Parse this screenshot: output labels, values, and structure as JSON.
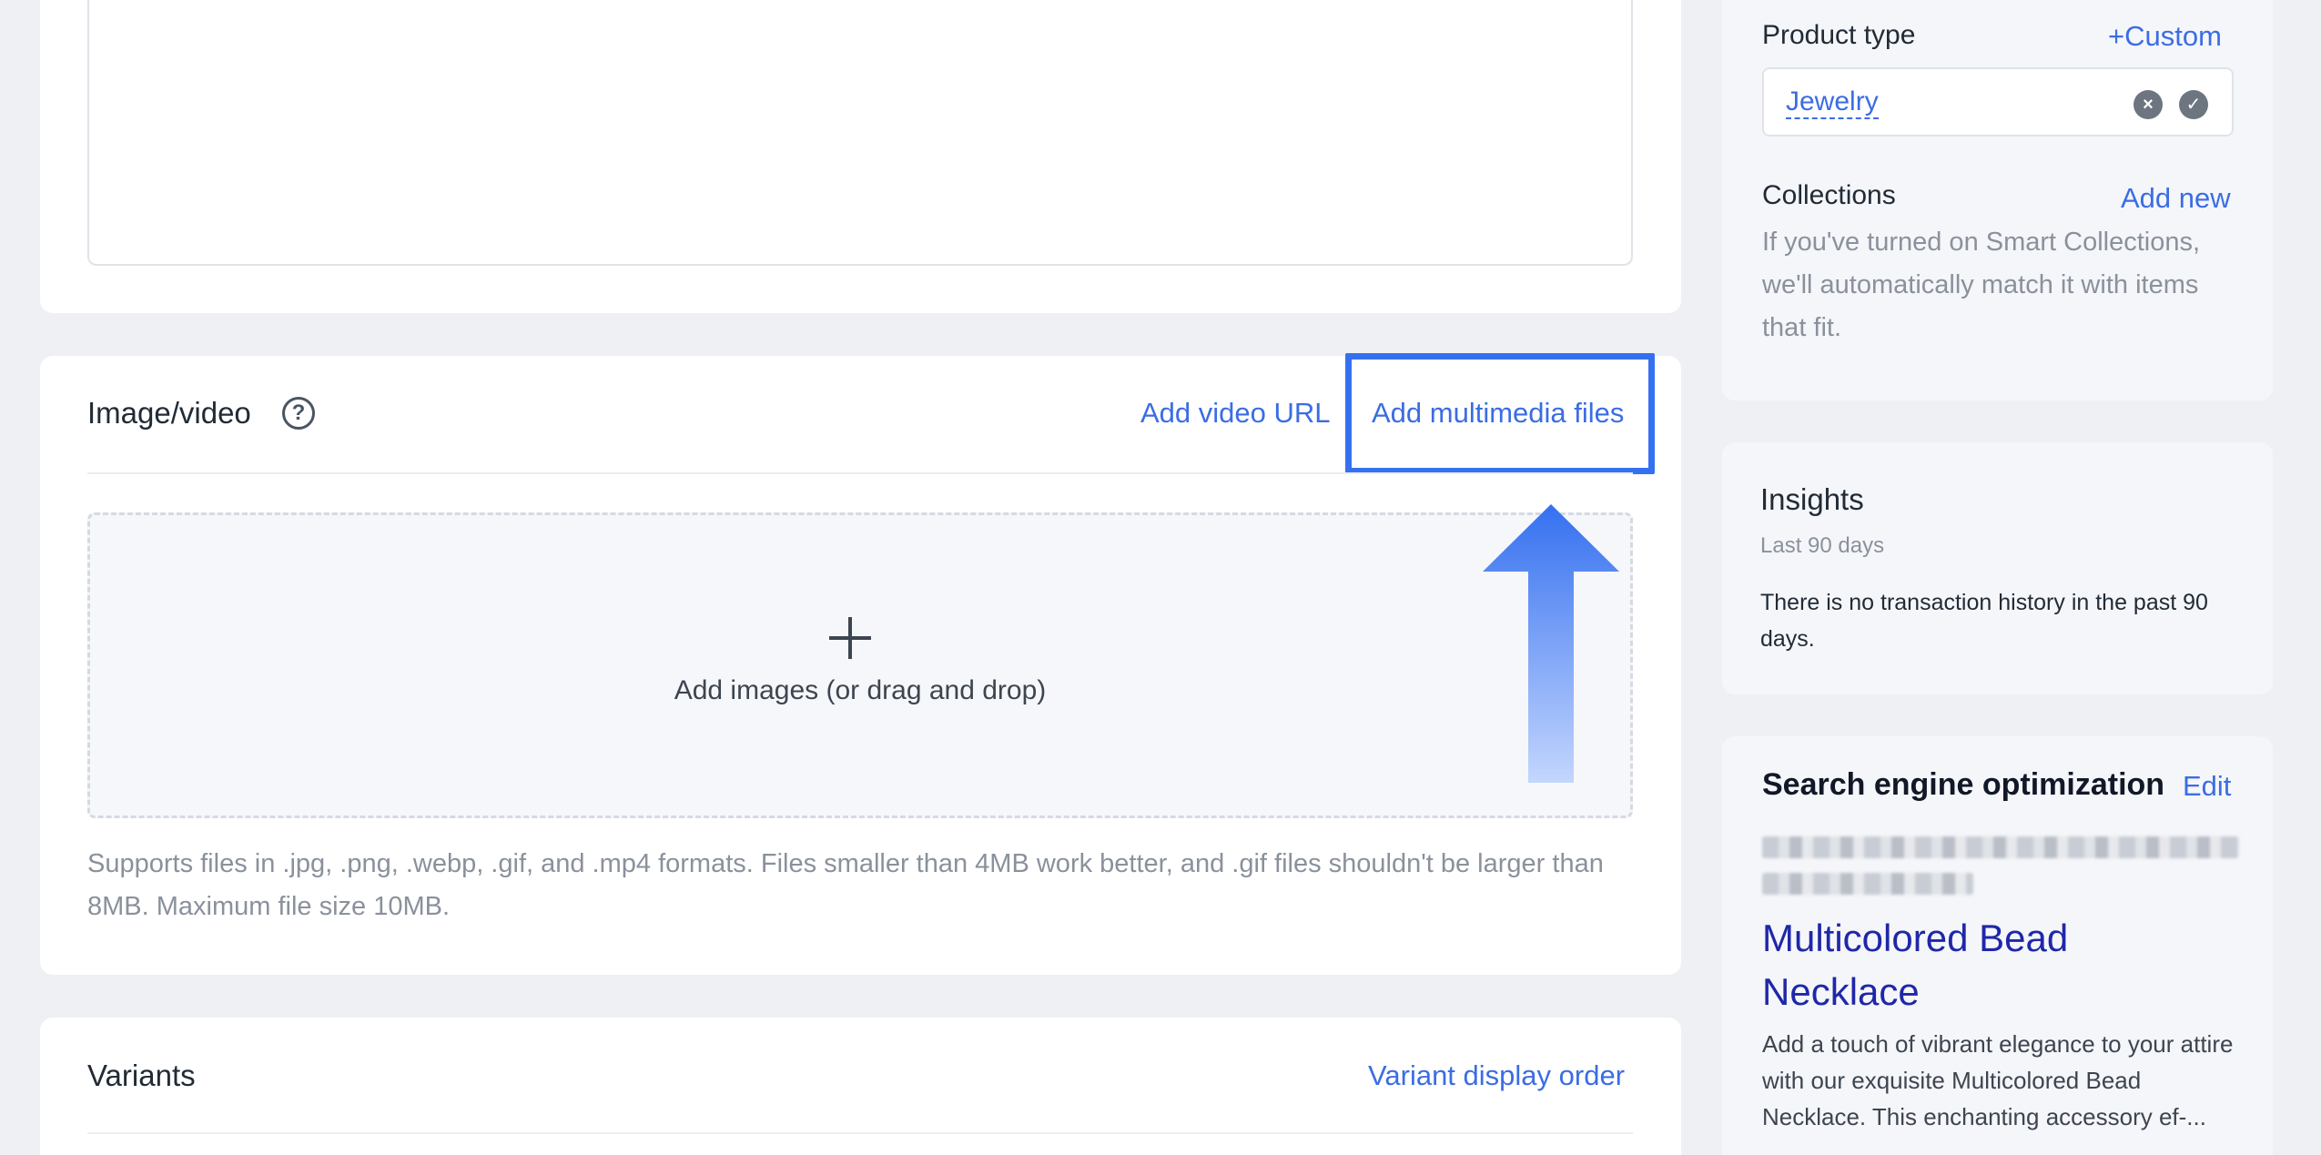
{
  "image_section": {
    "title": "Image/video",
    "add_video_url": "Add video URL",
    "add_multimedia_files": "Add multimedia files",
    "dropzone_label": "Add images (or drag and drop)",
    "support_text": "Supports files in .jpg, .png, .webp, .gif, and .mp4 formats. Files smaller than 4MB work better, and .gif files shouldn't be larger than 8MB. Maximum file size 10MB."
  },
  "variants_section": {
    "title": "Variants",
    "display_order_link": "Variant display order"
  },
  "product_organization": {
    "product_type_label": "Product type",
    "custom_link": "Custom",
    "custom_prefix": "+",
    "product_type_value": "Jewelry",
    "collections_label": "Collections",
    "add_new_link": "Add new",
    "collections_description": "If you've turned on Smart Collections, we'll automatically match it with items that fit."
  },
  "insights": {
    "title": "Insights",
    "period": "Last 90 days",
    "note": "There is no transaction history in the past 90 days."
  },
  "seo": {
    "title": "Search engine optimization",
    "edit_link": "Edit",
    "page_title": "Multicolored Bead Necklace",
    "description": "Add a touch of vibrant elegance to your attire with our exquisite Multicolored Bead Necklace. This enchanting accessory ef-..."
  },
  "colors": {
    "accent": "#3b6de3",
    "highlight": "#3570f0",
    "seo_title": "#1f27a8"
  }
}
